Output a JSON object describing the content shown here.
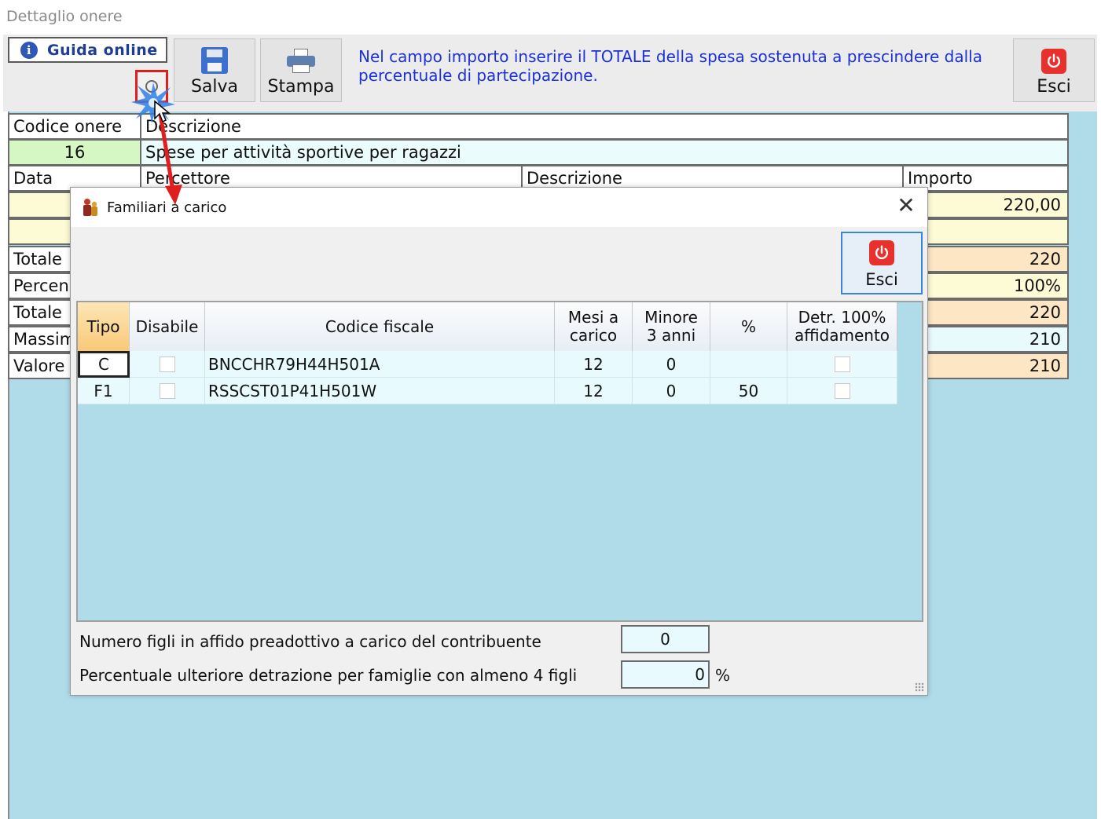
{
  "window": {
    "title": "Dettaglio onere"
  },
  "toolbar": {
    "guida_label": "Guida online",
    "salva_label": "Salva",
    "stampa_label": "Stampa",
    "esci_label": "Esci",
    "note": "Nel campo importo inserire il TOTALE della spesa sostenuta a prescindere dalla percentuale di partecipazione."
  },
  "form": {
    "codice_onere_label": "Codice onere",
    "descrizione_label": "Descrizione",
    "codice_onere_value": "16",
    "descrizione_value": "Spese per attività sportive per ragazzi",
    "data_label": "Data",
    "percettore_label": "Percettore",
    "descrizione2_label": "Descrizione",
    "importo_label": "Importo",
    "importo_value": "220,00",
    "rows": [
      {
        "label": "Totale",
        "value": "220"
      },
      {
        "label": "Percen",
        "value": "100%"
      },
      {
        "label": "Totale",
        "value": "220"
      },
      {
        "label": "Massim",
        "value": "210"
      },
      {
        "label": "Valore",
        "value": "210"
      }
    ]
  },
  "dialog": {
    "title": "Familiari a carico",
    "esci_label": "Esci",
    "columns": [
      "Tipo",
      "Disabile",
      "Codice fiscale",
      "Mesi a carico",
      "Minore 3 anni",
      "%",
      "Detr. 100% affidamento"
    ],
    "rows": [
      {
        "tipo": "C",
        "disabile": false,
        "codice_fiscale": "BNCCHR79H44H501A",
        "mesi": "12",
        "minore": "0",
        "perc": "",
        "affidamento": false
      },
      {
        "tipo": "F1",
        "disabile": false,
        "codice_fiscale": "RSSCST01P41H501W",
        "mesi": "12",
        "minore": "0",
        "perc": "50",
        "affidamento": false
      }
    ],
    "affido_label": "Numero figli in affido preadottivo a carico del contribuente",
    "affido_value": "0",
    "ulteriore_label": "Percentuale ulteriore detrazione per famiglie con almeno 4 figli",
    "ulteriore_value": "0",
    "ulteriore_unit": "%"
  },
  "colors": {
    "note_text": "#1c32d8",
    "highlight_red": "#e01e1e",
    "panel_bg": "#b0dcea",
    "green_cell": "#d4f7c3"
  }
}
